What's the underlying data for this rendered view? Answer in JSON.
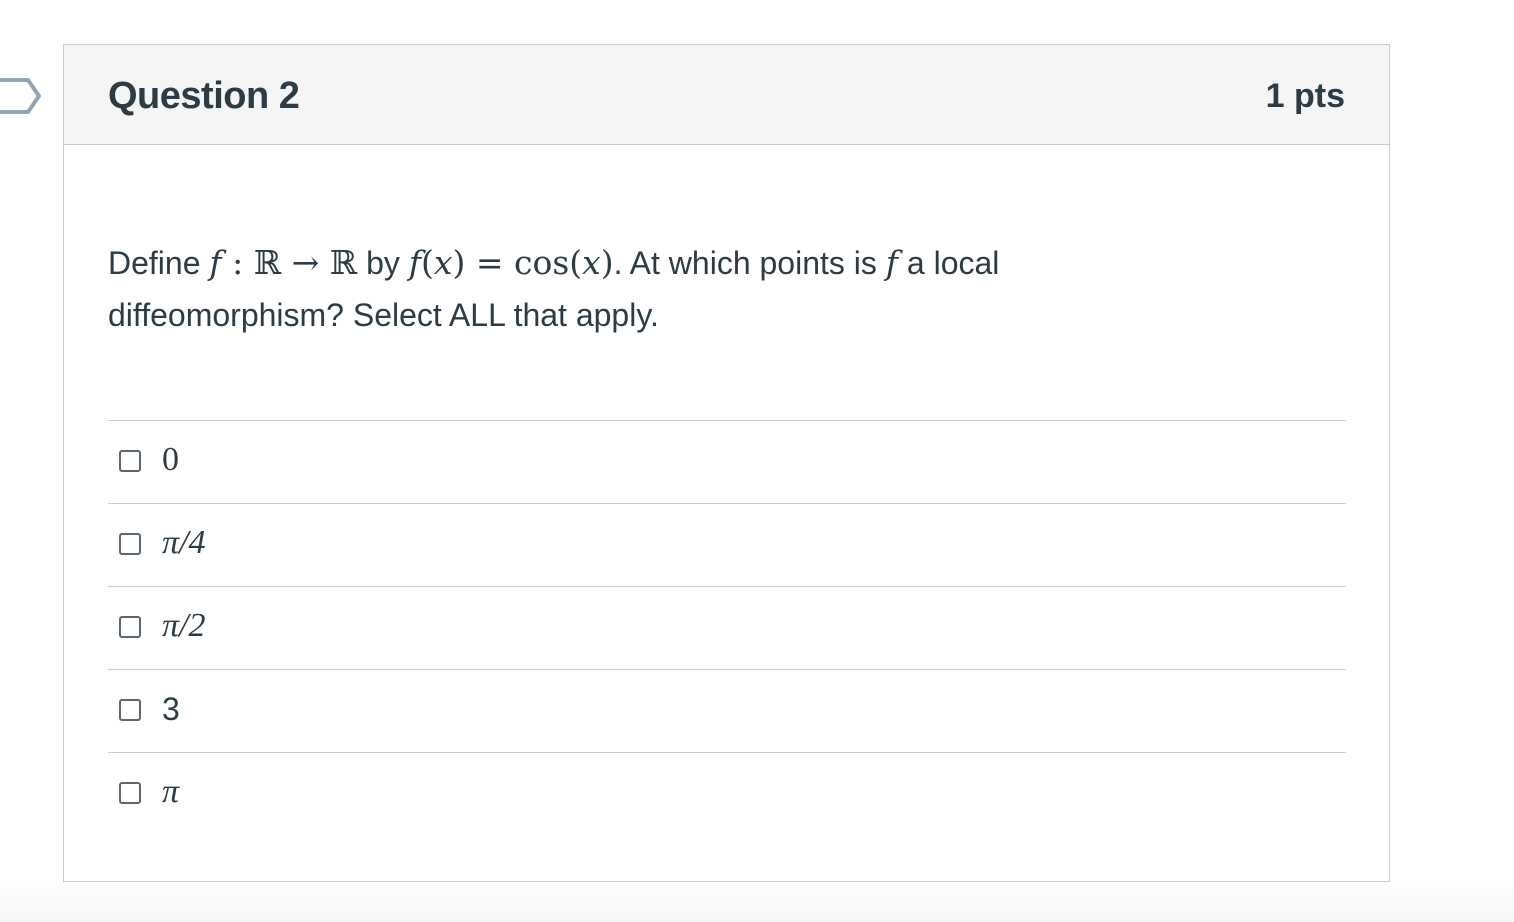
{
  "question": {
    "title": "Question 2",
    "points": "1 pts",
    "flag_icon": "bookmark-flag-icon",
    "text": {
      "p1": "Define ",
      "m1": "f",
      "m2": " : ℝ → ℝ",
      "p2": " by ",
      "m3": "f",
      "m4": "(",
      "m5": "x",
      "m6": ") = cos(",
      "m7": "x",
      "m8": ")",
      "p3": ". At which points is ",
      "m9": "f",
      "p4": " a local diffeomorphism? Select ALL that apply."
    }
  },
  "answers": [
    {
      "label": "0",
      "checked": false
    },
    {
      "label": "π/4",
      "checked": false
    },
    {
      "label": "π/2",
      "checked": false
    },
    {
      "label": "3",
      "checked": false
    },
    {
      "label": "π",
      "checked": false
    }
  ],
  "colors": {
    "text": "#2d3b45",
    "border": "#c7cdd1",
    "header_bg": "#f5f5f5",
    "flag_stroke": "#8fa6b8"
  }
}
